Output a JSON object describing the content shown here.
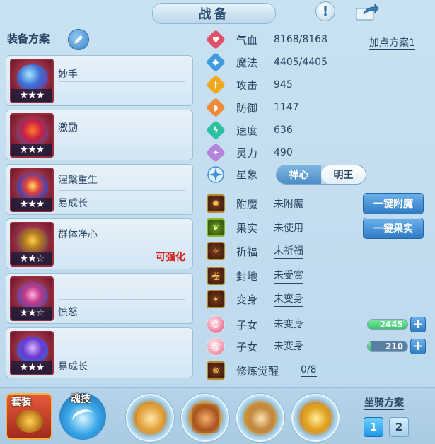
{
  "header": {
    "title": "战备"
  },
  "left": {
    "header": "装备方案",
    "cards": [
      {
        "name": "妙手",
        "stars": "★★★",
        "detail": "",
        "note": ""
      },
      {
        "name": "激励",
        "stars": "★★★",
        "detail": "",
        "note": ""
      },
      {
        "name": "涅槃重生",
        "stars": "★★★",
        "detail": "易成长",
        "note": ""
      },
      {
        "name": "群体净心",
        "stars": "★★☆",
        "detail": "",
        "note": "可强化"
      },
      {
        "name": "",
        "stars": "★★☆",
        "detail": "愤怒",
        "note": ""
      },
      {
        "name": "",
        "stars": "★★★",
        "detail": "易成长",
        "note": ""
      }
    ]
  },
  "stats": {
    "plan_link": "加点方案1",
    "hp": {
      "label": "气血",
      "value": "8168/8168"
    },
    "mp": {
      "label": "魔法",
      "value": "4405/4405"
    },
    "atk": {
      "label": "攻击",
      "value": "945"
    },
    "def": {
      "label": "防御",
      "value": "1147"
    },
    "spd": {
      "label": "速度",
      "value": "636"
    },
    "spi": {
      "label": "灵力",
      "value": "490"
    }
  },
  "star_sign": {
    "label": "星象",
    "options": [
      "禅心",
      "明王"
    ],
    "selected": "明王"
  },
  "extras": {
    "enchant": {
      "label": "附魔",
      "value": "未附魔",
      "button": "一键附魔"
    },
    "fruit": {
      "label": "果实",
      "value": "未使用",
      "button": "一键果实"
    },
    "bless": {
      "label": "祈福",
      "value": "未祈福"
    },
    "fief": {
      "label": "封地",
      "value": "未受赏"
    },
    "transform": {
      "label": "变身",
      "value": "未变身"
    },
    "child1": {
      "label": "子女",
      "value": "未变身",
      "bar_value": "2445"
    },
    "child2": {
      "label": "子女",
      "value": "未变身",
      "bar_value": "210"
    },
    "cultivate": {
      "label": "修炼觉醒",
      "value": "0/8"
    }
  },
  "bottom": {
    "set_label": "套装",
    "soul_label": "魂技",
    "mount_title": "坐骑方案",
    "mount_slots": [
      "1",
      "2"
    ],
    "active_slot": "1"
  },
  "colors": {
    "hp_icon": "#e0506a",
    "mp_icon": "#3f9be0",
    "atk_icon": "#f0a81e",
    "def_icon": "#ee8a3a",
    "spd_icon": "#2cc2a0",
    "spi_icon": "#b284de",
    "red_note": "#d0201c",
    "bar_green": "#39c26a",
    "bar_blue": "#6087b0"
  }
}
